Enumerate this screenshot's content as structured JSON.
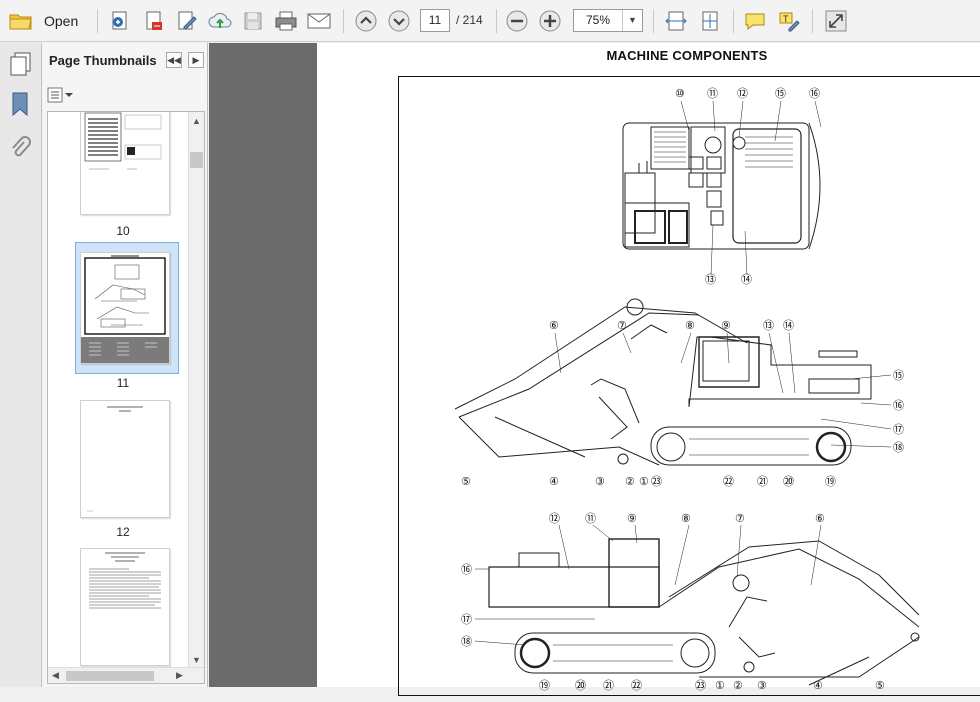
{
  "toolbar": {
    "open_label": "Open",
    "current_page": "11",
    "page_total": "/ 214",
    "zoom": "75%",
    "icons": [
      "folder-icon",
      "create-pdf-icon",
      "export-pdf-icon",
      "edit-icon",
      "upload-icon",
      "save-icon",
      "print-icon",
      "email-icon",
      "page-up-icon",
      "page-down-icon",
      "zoom-out-icon",
      "zoom-in-icon",
      "fit-width-icon",
      "fit-page-icon",
      "comment-icon",
      "highlight-icon",
      "expand-icon"
    ]
  },
  "sidebar": {
    "title": "Page Thumbnails",
    "thumbnails": [
      {
        "label": "10"
      },
      {
        "label": "11",
        "selected": true
      },
      {
        "label": "12"
      },
      {
        "label": ""
      }
    ]
  },
  "document": {
    "heading": "MACHINE COMPONENTS",
    "callouts_top": [
      "⑩",
      "⑪",
      "⑫",
      "⑮",
      "⑯",
      "⑬",
      "⑭"
    ],
    "callouts_side": [
      "⑥",
      "⑦",
      "⑧",
      "⑨",
      "⑬",
      "⑭",
      "⑮",
      "⑯",
      "⑰",
      "⑱",
      "⑤",
      "④",
      "③",
      "②",
      "①",
      "㉓",
      "㉒",
      "㉑",
      "⑳",
      "⑲"
    ],
    "callouts_bottom": [
      "⑫",
      "⑪",
      "⑨",
      "⑧",
      "⑦",
      "⑥",
      "⑯",
      "⑰",
      "⑱",
      "⑲",
      "⑳",
      "㉑",
      "㉒",
      "㉓",
      "①",
      "②",
      "③",
      "④",
      "⑤"
    ]
  },
  "colors": {
    "toolbar_bg": "#f3f3f3",
    "gutter": "#6b6b6b",
    "selection": "#cfe4f7",
    "accent": "#2c6fbb"
  }
}
